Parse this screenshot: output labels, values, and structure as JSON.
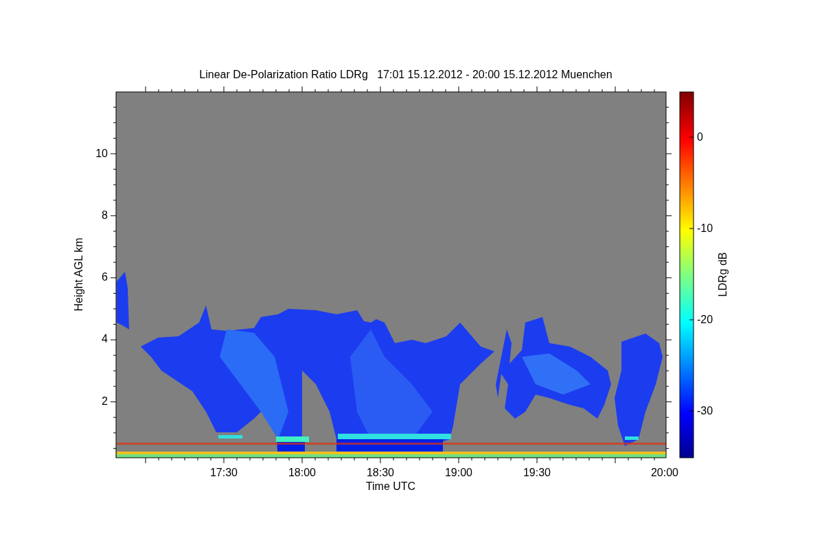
{
  "figure": {
    "title": "Linear De-Polarization Ratio LDRg   17:01 15.12.2012 - 20:00 15.12.2012 Muenchen",
    "ylabel": "Height AGL km",
    "xlabel": "Time UTC",
    "yticks": [
      "10",
      "8",
      "6",
      "4",
      "2"
    ],
    "xticks": [
      "17:30",
      "18:00",
      "18:30",
      "19:00",
      "19:30",
      "20:00"
    ],
    "colorbar": {
      "label": "LDRg dB",
      "ticks": [
        "0",
        "-10",
        "-20",
        "-30"
      ]
    }
  }
}
